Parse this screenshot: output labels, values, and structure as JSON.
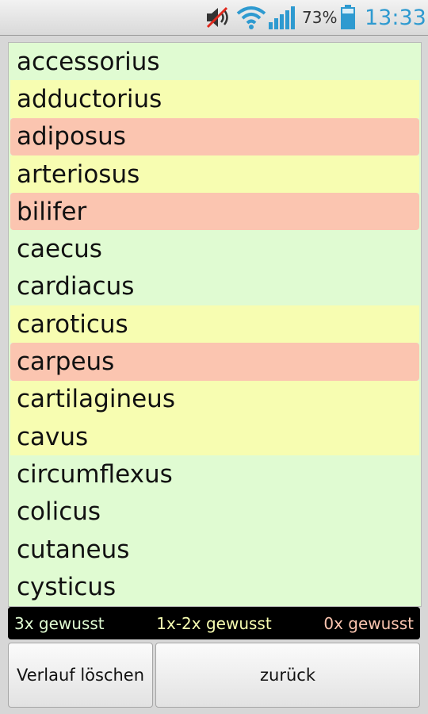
{
  "status_bar": {
    "battery_percent": "73%",
    "time": "13:33",
    "icons": [
      "mute-icon",
      "wifi-icon",
      "signal-icon",
      "battery-icon"
    ],
    "accent": "#2e9ad0"
  },
  "list": {
    "items": [
      {
        "label": "accessorius",
        "status": "green"
      },
      {
        "label": "adductorius",
        "status": "yellow"
      },
      {
        "label": "adiposus",
        "status": "red"
      },
      {
        "label": "arteriosus",
        "status": "yellow"
      },
      {
        "label": "bilifer",
        "status": "red"
      },
      {
        "label": "caecus",
        "status": "green"
      },
      {
        "label": "cardiacus",
        "status": "green"
      },
      {
        "label": "caroticus",
        "status": "yellow"
      },
      {
        "label": "carpeus",
        "status": "red"
      },
      {
        "label": "cartilagineus",
        "status": "yellow"
      },
      {
        "label": "cavus",
        "status": "yellow"
      },
      {
        "label": "circumflexus",
        "status": "green"
      },
      {
        "label": "colicus",
        "status": "green"
      },
      {
        "label": "cutaneus",
        "status": "green"
      },
      {
        "label": "cysticus",
        "status": "green"
      }
    ],
    "colors": {
      "green": "#e0fbd2",
      "yellow": "#f7fdb1",
      "red": "#fbc5b0"
    }
  },
  "legend": {
    "known_3x": "3x gewusst",
    "known_1x_2x": "1x-2x gewusst",
    "known_0x": "0x gewusst",
    "colors": {
      "known_3x": "#e0fbd2",
      "known_1x_2x": "#f7fdb1",
      "known_0x": "#fbc5b0"
    }
  },
  "buttons": {
    "clear_history": "Verlauf löschen",
    "back": "zurück"
  }
}
